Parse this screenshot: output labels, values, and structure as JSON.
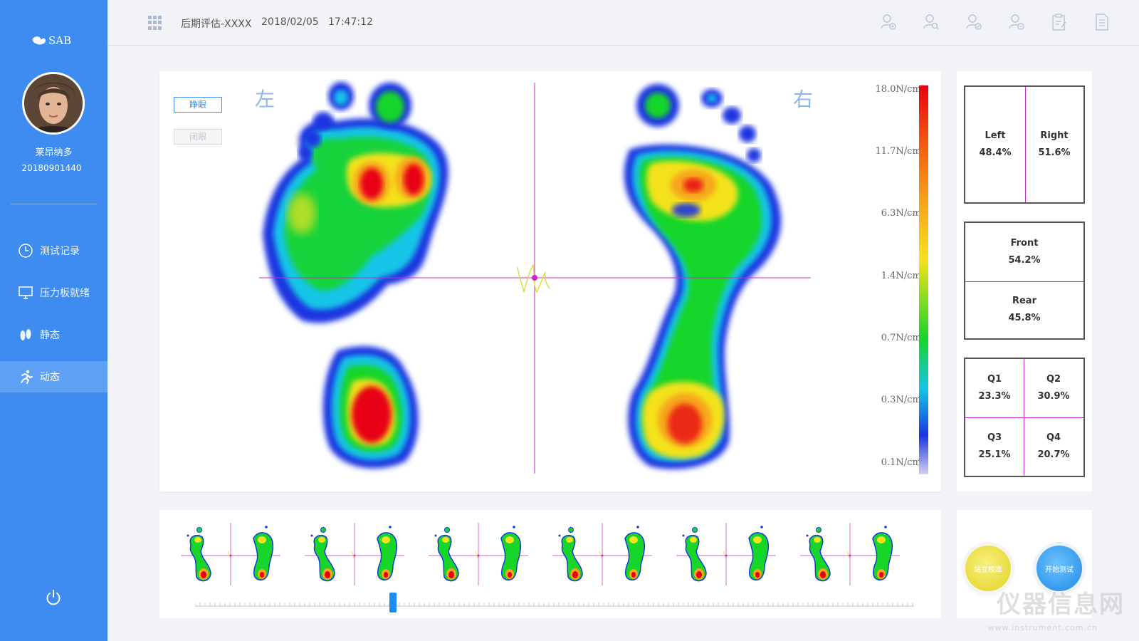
{
  "app": {
    "logo_text": "SAB"
  },
  "user": {
    "name": "莱昂纳多",
    "id": "20180901440"
  },
  "sidebar": {
    "items": [
      {
        "label": "测试记录",
        "icon": "clock-icon",
        "active": false
      },
      {
        "label": "压力板就绪",
        "icon": "monitor-icon",
        "active": false
      },
      {
        "label": "静态",
        "icon": "footprints-icon",
        "active": false
      },
      {
        "label": "动态",
        "icon": "running-icon",
        "active": true
      }
    ]
  },
  "header": {
    "title": "后期评估-XXXX",
    "date": "2018/02/05",
    "time": "17:47:12",
    "icons": [
      "add-user-icon",
      "search-user-icon",
      "user-check-icon",
      "user-minus-icon",
      "clipboard-edit-icon",
      "document-icon"
    ]
  },
  "plot": {
    "left_label": "左",
    "right_label": "右",
    "eyes_open_label": "睁眼",
    "eyes_closed_label": "闭眼",
    "scale": [
      "18.0N/cm²",
      "11.7N/cm²",
      "6.3N/cm²",
      "1.4N/cm²",
      "0.7N/cm²",
      "0.3N/cm²",
      "0.1N/cm²"
    ],
    "colors": {
      "high": "#e80012",
      "mid_high": "#f7a51a",
      "mid": "#f3e21c",
      "mid_low": "#18d52a",
      "low": "#16c5e7",
      "min": "#1a36e0",
      "crosshair": "#c92bc9"
    }
  },
  "distribution": {
    "lr": {
      "left_label": "Left",
      "left_value": "48.4%",
      "right_label": "Right",
      "right_value": "51.6%"
    },
    "fr": {
      "front_label": "Front",
      "front_value": "54.2%",
      "rear_label": "Rear",
      "rear_value": "45.8%"
    },
    "quadrants": {
      "q1_label": "Q1",
      "q1_value": "23.3%",
      "q2_label": "Q2",
      "q2_value": "30.9%",
      "q3_label": "Q3",
      "q3_value": "25.1%",
      "q4_label": "Q4",
      "q4_value": "20.7%"
    }
  },
  "timeline": {
    "frame_count": 6,
    "slider_position": 0.275
  },
  "actions": {
    "calibrate_label": "站立校准",
    "start_label": "开始测试"
  },
  "watermark": {
    "text": "仪器信息网",
    "url": "www.instrument.com.cn"
  }
}
